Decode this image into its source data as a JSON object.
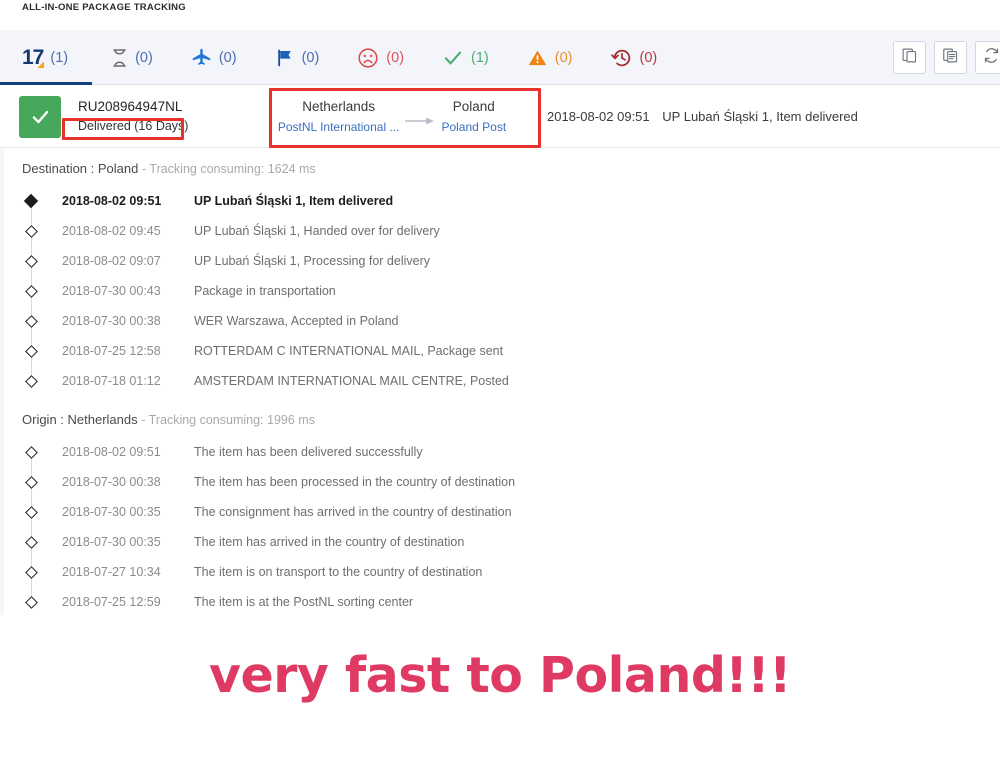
{
  "brand": {
    "title": "ALL-IN-ONE PACKAGE TRACKING"
  },
  "tabs": [
    {
      "name": "tab-all",
      "icon": "17track-logo",
      "count": "(1)"
    },
    {
      "name": "tab-pending",
      "icon": "hourglass-icon",
      "count": "(0)"
    },
    {
      "name": "tab-transit",
      "icon": "plane-icon",
      "count": "(0)"
    },
    {
      "name": "tab-pickup",
      "icon": "flag-icon",
      "count": "(0)"
    },
    {
      "name": "tab-undelivered",
      "icon": "sad-face-icon",
      "count": "(0)"
    },
    {
      "name": "tab-delivered",
      "icon": "check-icon",
      "count": "(1)"
    },
    {
      "name": "tab-alert",
      "icon": "warning-icon",
      "count": "(0)"
    },
    {
      "name": "tab-expired",
      "icon": "history-icon",
      "count": "(0)"
    }
  ],
  "toolbar": {
    "copy_label": "copy-icon",
    "copy_details_label": "copy-details-icon",
    "refresh_label": "refresh-icon"
  },
  "package": {
    "tracking_number": "RU208964947NL",
    "status": "Delivered (16 Days)",
    "origin_country": "Netherlands",
    "origin_carrier": "PostNL International ...",
    "destination_country": "Poland",
    "destination_carrier": "Poland Post",
    "last_event_time": "2018-08-02 09:51",
    "last_event_desc": "UP Lubań Śląski 1, Item delivered"
  },
  "destination": {
    "heading": "Destination : Poland",
    "timing": "- Tracking consuming: 1624 ms",
    "events": [
      {
        "time": "2018-08-02 09:51",
        "desc": "UP Lubań Śląski 1, Item delivered",
        "current": true
      },
      {
        "time": "2018-08-02 09:45",
        "desc": "UP Lubań Śląski 1, Handed over for delivery",
        "current": false
      },
      {
        "time": "2018-08-02 09:07",
        "desc": "UP Lubań Śląski 1, Processing for delivery",
        "current": false
      },
      {
        "time": "2018-07-30 00:43",
        "desc": "Package in transportation",
        "current": false
      },
      {
        "time": "2018-07-30 00:38",
        "desc": "WER Warszawa, Accepted in Poland",
        "current": false
      },
      {
        "time": "2018-07-25 12:58",
        "desc": "ROTTERDAM C INTERNATIONAL MAIL, Package sent",
        "current": false
      },
      {
        "time": "2018-07-18 01:12",
        "desc": "AMSTERDAM INTERNATIONAL MAIL CENTRE, Posted",
        "current": false
      }
    ]
  },
  "origin": {
    "heading": "Origin : Netherlands",
    "timing": "- Tracking consuming: 1996 ms",
    "events": [
      {
        "time": "2018-08-02 09:51",
        "desc": "The item has been delivered successfully",
        "current": false
      },
      {
        "time": "2018-07-30 00:38",
        "desc": "The item has been processed in the country of destination",
        "current": false
      },
      {
        "time": "2018-07-30 00:35",
        "desc": "The consignment has arrived in the country of destination",
        "current": false
      },
      {
        "time": "2018-07-30 00:35",
        "desc": "The item has arrived in the country of destination",
        "current": false
      },
      {
        "time": "2018-07-27 10:34",
        "desc": "The item is on transport to the country of destination",
        "current": false
      },
      {
        "time": "2018-07-25 12:59",
        "desc": "The item is at the PostNL sorting center",
        "current": false
      }
    ]
  },
  "overlay": {
    "caption": "very fast to Poland!!!"
  },
  "colors": {
    "accent_navy": "#11407f",
    "status_green": "#45a85b",
    "annotation_red": "#e8302c",
    "caption_pink": "#de3a63",
    "link_blue": "#3a6fc4"
  }
}
